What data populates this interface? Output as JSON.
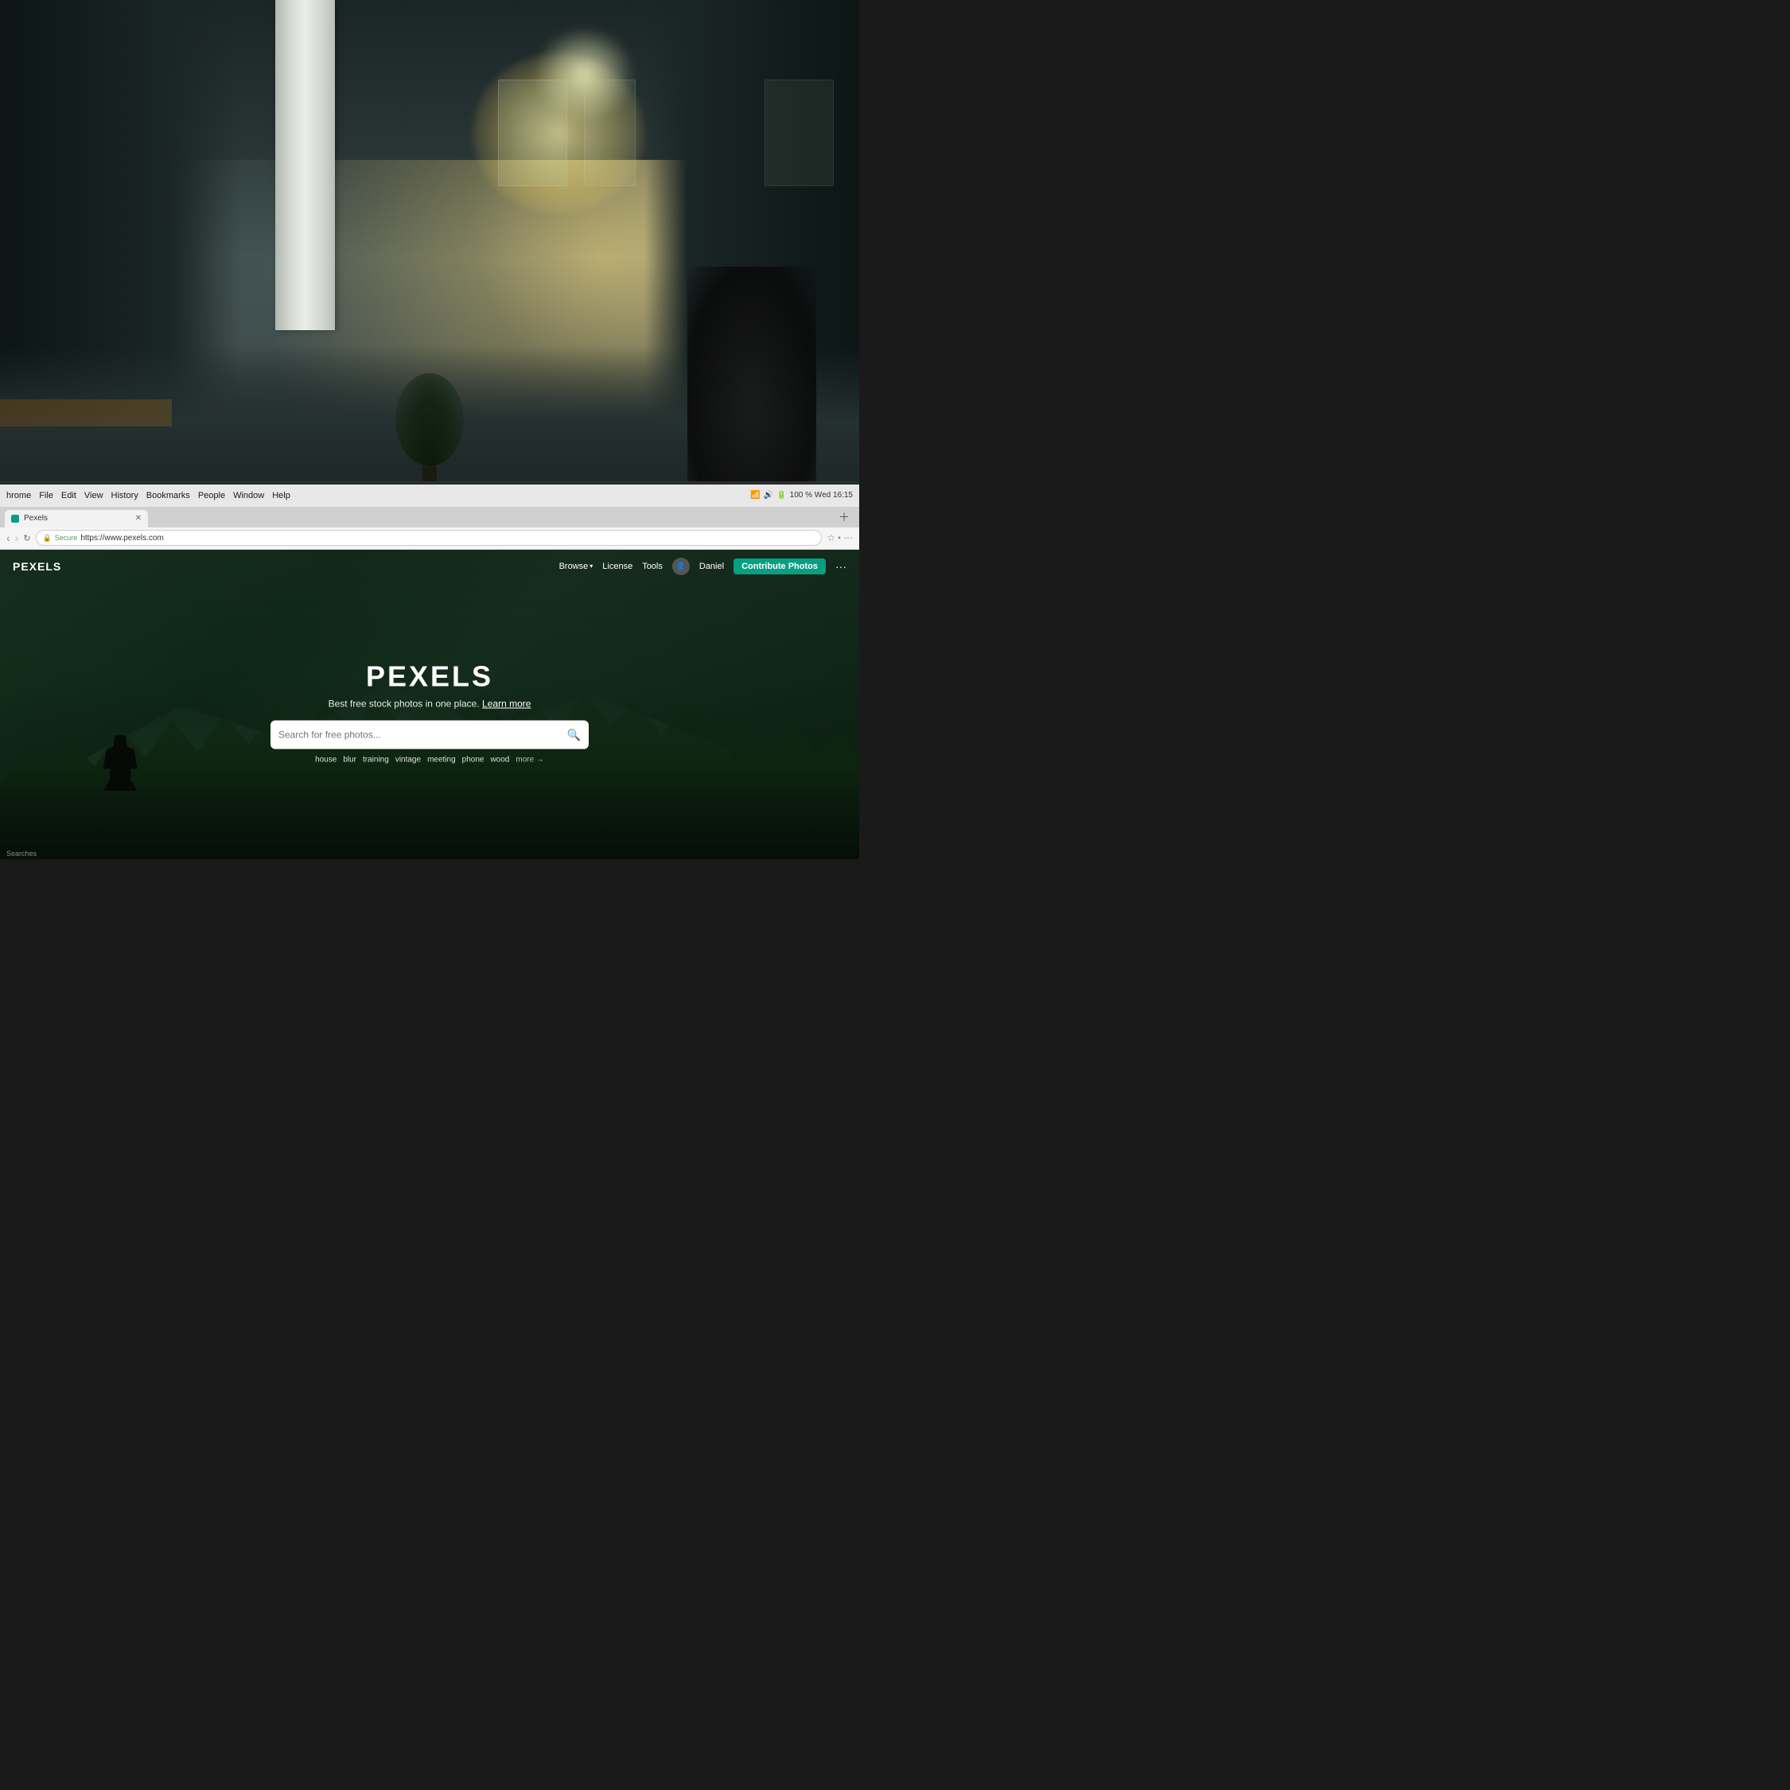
{
  "background": {
    "description": "office interior with bokeh light"
  },
  "chrome": {
    "menu_items": [
      "hrome",
      "File",
      "Edit",
      "View",
      "History",
      "Bookmarks",
      "People",
      "Window",
      "Help"
    ],
    "status_right": "100 %  Wed 16:15",
    "url": "https://www.pexels.com",
    "secure_label": "Secure",
    "tab_title": "Pexels"
  },
  "pexels": {
    "nav": {
      "browse_label": "Browse",
      "license_label": "License",
      "tools_label": "Tools",
      "user_name": "Daniel",
      "contribute_label": "Contribute Photos",
      "more_label": "···"
    },
    "hero": {
      "title": "PEXELS",
      "subtitle": "Best free stock photos in one place.",
      "subtitle_link": "Learn more",
      "search_placeholder": "Search for free photos...",
      "tags": [
        "house",
        "blur",
        "training",
        "vintage",
        "meeting",
        "phone",
        "wood"
      ],
      "tags_more": "more →"
    },
    "footer_label": "Searches"
  }
}
